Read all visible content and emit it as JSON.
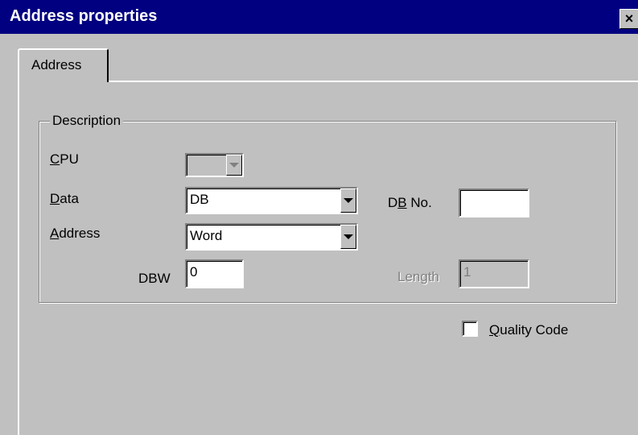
{
  "window": {
    "title": "Address properties",
    "close_label": "×"
  },
  "tabs": [
    {
      "label": "Address",
      "selected": true
    }
  ],
  "group": {
    "legend": "Description"
  },
  "fields": {
    "cpu": {
      "label_mnemonic": "C",
      "label_rest": "PU",
      "value": "",
      "enabled": false
    },
    "data": {
      "label_mnemonic": "D",
      "label_rest": "ata",
      "value": "DB"
    },
    "address": {
      "label_mnemonic": "A",
      "label_rest": "ddress",
      "value": "Word"
    },
    "dbw": {
      "label": "DBW",
      "value": "0"
    },
    "db_no": {
      "label_pre": "D",
      "label_mnemonic": "B",
      "label_rest": " No.",
      "value": ""
    },
    "length": {
      "label": "Length",
      "value": "1",
      "enabled": false
    }
  },
  "quality_code": {
    "label_mnemonic": "Q",
    "label_rest": "uality Code",
    "checked": false
  },
  "icons": {
    "close": "close-icon",
    "dropdown": "chevron-down-icon"
  }
}
